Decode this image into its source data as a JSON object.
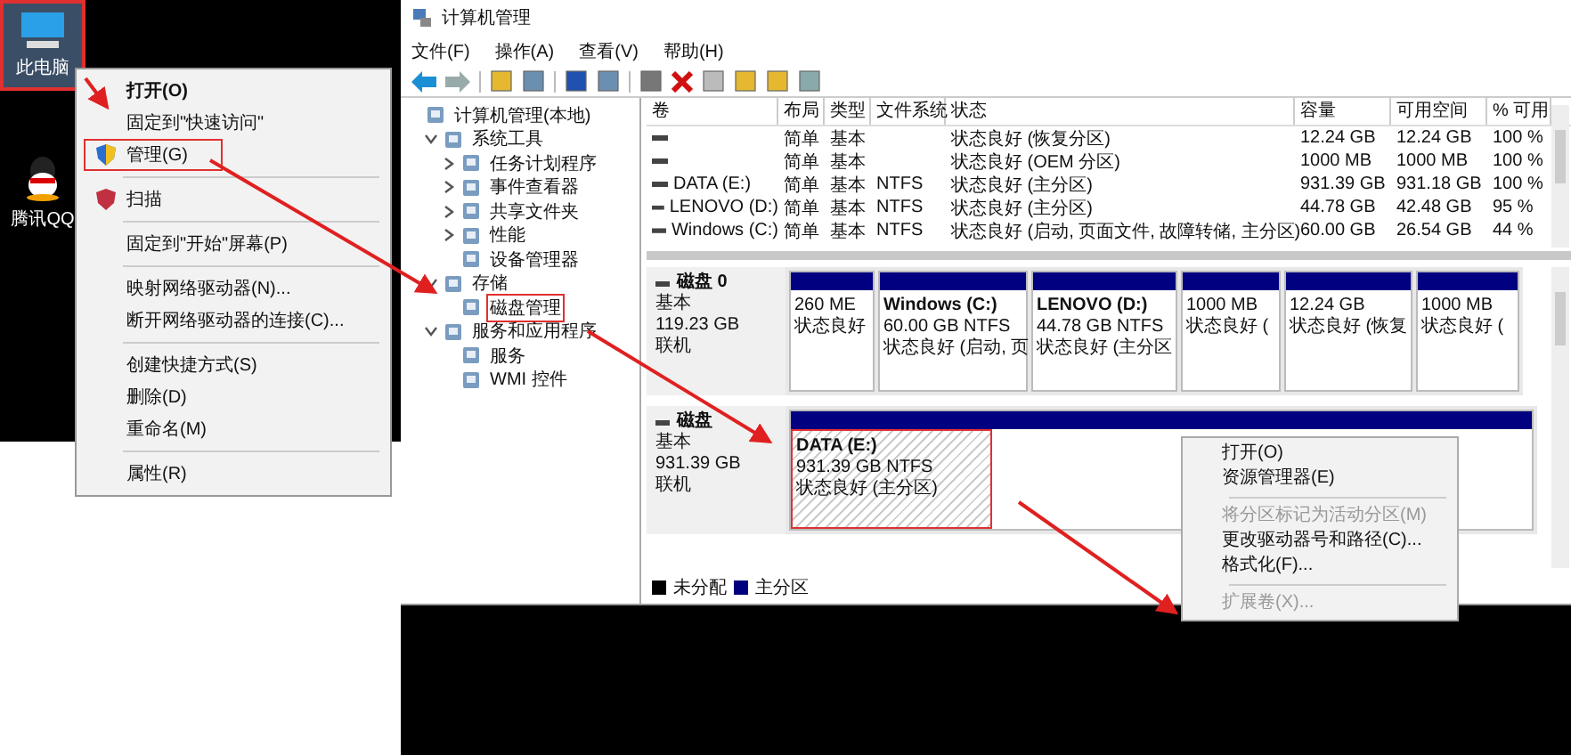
{
  "desktop": {
    "icons": [
      {
        "label": "此电脑",
        "kind": "computer",
        "selected": true
      },
      {
        "label": "腾讯QQ",
        "kind": "app",
        "selected": false
      }
    ]
  },
  "desktop_menu": {
    "items": [
      {
        "kind": "item",
        "label": "打开(O)",
        "bold": true,
        "highlighted": false
      },
      {
        "kind": "item",
        "label": "固定到\"快速访问\"",
        "bold": false,
        "highlighted": false
      },
      {
        "kind": "shield",
        "label": "管理(G)",
        "bold": false,
        "highlighted": true
      },
      {
        "kind": "separator"
      },
      {
        "kind": "scan",
        "label": "扫描",
        "bold": false,
        "highlighted": false
      },
      {
        "kind": "separator"
      },
      {
        "kind": "item",
        "label": "固定到\"开始\"屏幕(P)",
        "bold": false,
        "highlighted": false
      },
      {
        "kind": "separator"
      },
      {
        "kind": "item",
        "label": "映射网络驱动器(N)...",
        "bold": false,
        "highlighted": false
      },
      {
        "kind": "item",
        "label": "断开网络驱动器的连接(C)...",
        "bold": false,
        "highlighted": false
      },
      {
        "kind": "separator"
      },
      {
        "kind": "item",
        "label": "创建快捷方式(S)",
        "bold": false,
        "highlighted": false
      },
      {
        "kind": "item",
        "label": "删除(D)",
        "bold": false,
        "highlighted": false
      },
      {
        "kind": "item",
        "label": "重命名(M)",
        "bold": false,
        "highlighted": false
      },
      {
        "kind": "separator"
      },
      {
        "kind": "item",
        "label": "属性(R)",
        "bold": false,
        "highlighted": false
      }
    ]
  },
  "window": {
    "title": "计算机管理",
    "menu": [
      "文件(F)",
      "操作(A)",
      "查看(V)",
      "帮助(H)"
    ],
    "tree": [
      {
        "label": "计算机管理(本地)",
        "highlighted": false,
        "children": [
          {
            "label": "系统工具",
            "expanded": true,
            "highlighted": false,
            "children": [
              {
                "label": "任务计划程序",
                "expanded": false,
                "highlighted": false
              },
              {
                "label": "事件查看器",
                "expanded": false,
                "highlighted": false
              },
              {
                "label": "共享文件夹",
                "expanded": false,
                "highlighted": false
              },
              {
                "label": "性能",
                "expanded": false,
                "highlighted": false
              },
              {
                "label": "设备管理器",
                "highlighted": false
              }
            ]
          },
          {
            "label": "存储",
            "expanded": true,
            "highlighted": false,
            "children": [
              {
                "label": "磁盘管理",
                "highlighted": true
              }
            ]
          },
          {
            "label": "服务和应用程序",
            "expanded": true,
            "highlighted": false,
            "children": [
              {
                "label": "服务",
                "highlighted": false
              },
              {
                "label": "WMI 控件",
                "highlighted": false
              }
            ]
          }
        ]
      }
    ],
    "table": {
      "columns": [
        "卷",
        "布局",
        "类型",
        "文件系统",
        "状态",
        "容量",
        "可用空间",
        "% 可用"
      ],
      "rows": [
        [
          "",
          "简单",
          "基本",
          "",
          "状态良好 (恢复分区)",
          "12.24 GB",
          "12.24 GB",
          "100 %"
        ],
        [
          "",
          "简单",
          "基本",
          "",
          "状态良好 (OEM 分区)",
          "1000 MB",
          "1000 MB",
          "100 %"
        ],
        [
          "DATA (E:)",
          "简单",
          "基本",
          "NTFS",
          "状态良好 (主分区)",
          "931.39 GB",
          "931.18 GB",
          "100 %"
        ],
        [
          "LENOVO (D:)",
          "简单",
          "基本",
          "NTFS",
          "状态良好 (主分区)",
          "44.78 GB",
          "42.48 GB",
          "95 %"
        ],
        [
          "Windows (C:)",
          "简单",
          "基本",
          "NTFS",
          "状态良好 (启动, 页面文件, 故障转储, 主分区)",
          "60.00 GB",
          "26.54 GB",
          "44 %"
        ]
      ]
    },
    "disks": [
      {
        "name": "磁盘 0",
        "type": "基本",
        "size": "119.23 GB",
        "status": "联机",
        "partitions": [
          {
            "size": "260 ME",
            "status": "状态良好",
            "selected": false
          },
          {
            "title": "Windows  (C:)",
            "size": "60.00 GB NTFS",
            "status": "状态良好 (启动, 页",
            "selected": false
          },
          {
            "title": "LENOVO  (D:)",
            "size": "44.78 GB NTFS",
            "status": "状态良好 (主分区",
            "selected": false
          },
          {
            "size": "1000 MB",
            "status": "状态良好 (",
            "selected": false
          },
          {
            "size": "12.24 GB",
            "status": "状态良好 (恢复",
            "selected": false
          },
          {
            "size": "1000 MB",
            "status": "状态良好 (",
            "selected": false
          }
        ]
      },
      {
        "name": "磁盘",
        "type": "基本",
        "size": "931.39 GB",
        "status": "联机",
        "partitions": [
          {
            "title": "DATA  (E:)",
            "size": "931.39 GB NTFS",
            "status": "状态良好 (主分区)",
            "selected": true,
            "highlighted": true
          }
        ]
      }
    ],
    "legend": [
      {
        "label": "未分配",
        "color": "#000000"
      },
      {
        "label": "主分区",
        "color": "#00007f"
      }
    ],
    "partition_menu": {
      "items": [
        {
          "label": "打开(O)",
          "disabled": false
        },
        {
          "label": "资源管理器(E)",
          "disabled": false
        },
        {
          "kind": "separator"
        },
        {
          "label": "将分区标记为活动分区(M)",
          "disabled": true
        },
        {
          "label": "更改驱动器号和路径(C)...",
          "disabled": false
        },
        {
          "label": "格式化(F)...",
          "disabled": false
        },
        {
          "kind": "separator"
        },
        {
          "label": "扩展卷(X)...",
          "disabled": true
        }
      ]
    }
  }
}
